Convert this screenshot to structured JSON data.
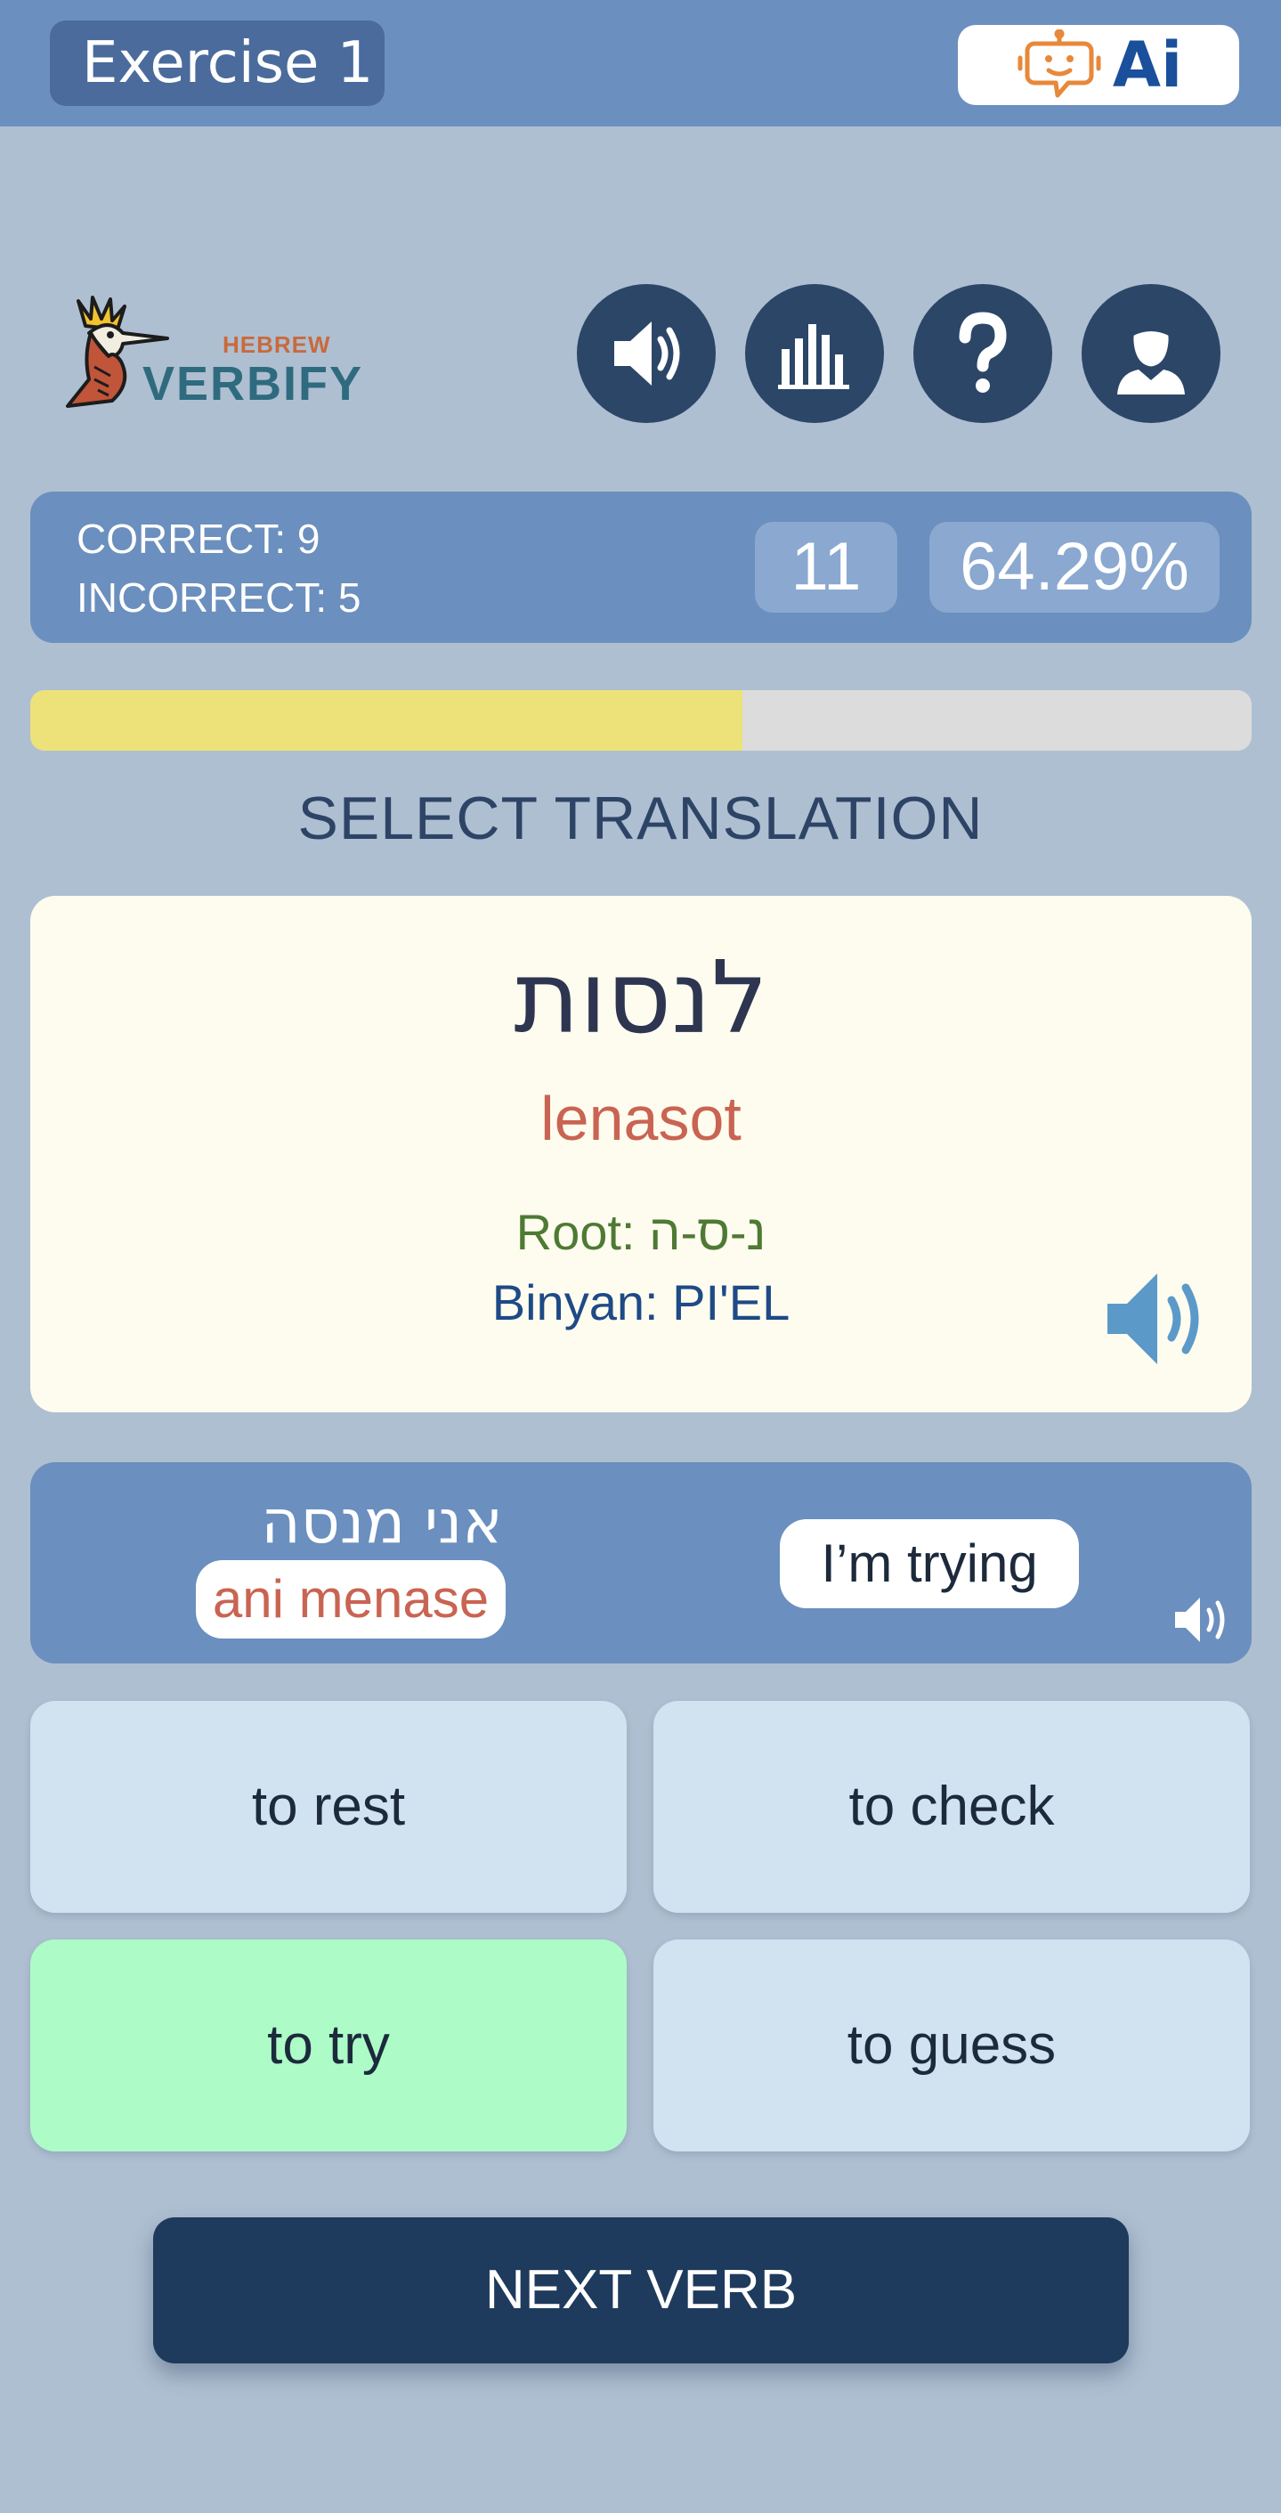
{
  "header": {
    "exercise_label": "Exercise 1",
    "ai_label": "Ai"
  },
  "logo": {
    "small_text": "HEBREW",
    "big_text": "VERBIFY"
  },
  "toolbar": {
    "icons": [
      "speaker-icon",
      "bar-chart-icon",
      "help-icon",
      "user-icon"
    ]
  },
  "stats": {
    "correct_label": "CORRECT: 9",
    "incorrect_label": "INCORRECT: 5",
    "streak": "11",
    "accuracy": "64.29%"
  },
  "progress": {
    "fraction": 0.583
  },
  "instruction": "SELECT TRANSLATION",
  "verb": {
    "hebrew": "לנסות",
    "transliteration": "lenasot",
    "root": "Root: נ-ס-ה",
    "binyan": "Binyan: PI'EL"
  },
  "example": {
    "hebrew": "אני מנסה",
    "transliteration": "ani menase",
    "english": "I’m trying"
  },
  "options": [
    {
      "label": "to rest",
      "state": "default"
    },
    {
      "label": "to check",
      "state": "default"
    },
    {
      "label": "to try",
      "state": "correct"
    },
    {
      "label": "to guess",
      "state": "default"
    }
  ],
  "next_button": "NEXT VERB",
  "colors": {
    "background": "#aebfd1",
    "header": "#6b8fbe",
    "dark_button": "#2c4668",
    "correct_option": "#adfcc8",
    "option": "#d1e2f0",
    "progress_fill": "#ede17a",
    "transliteration": "#c96452"
  }
}
